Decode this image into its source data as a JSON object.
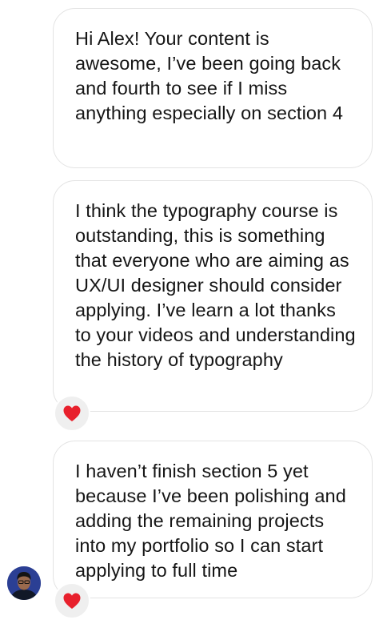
{
  "messages": [
    {
      "text": "Hi Alex! Your content is awesome, I’ve been going back and fourth to see if I miss anything especially on section 4"
    },
    {
      "text": "I think the typography course is outstanding, this is something that everyone who are aiming as UX/UI designer should consider applying. I’ve learn a lot thanks to your videos and understanding the history of typography",
      "reaction": "heart"
    },
    {
      "text": "I haven’t finish section 5 yet because I’ve been polishing and adding the remaining projects into my portfolio so I can start applying to full time",
      "reaction": "heart"
    }
  ],
  "colors": {
    "heart": "#e8202c",
    "bubble_border": "#e3e3e3",
    "reaction_bg": "#efefef"
  },
  "icons": {
    "reaction": "heart-icon",
    "avatar": "user-avatar"
  }
}
